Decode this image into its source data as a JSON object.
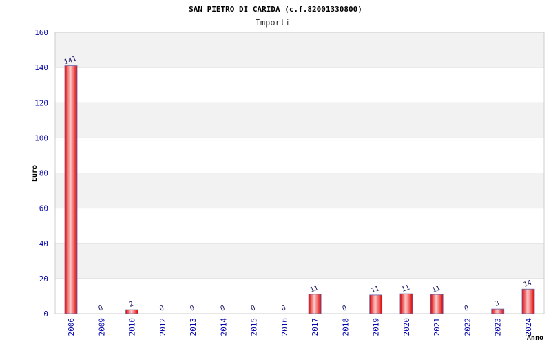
{
  "chart_data": {
    "type": "bar",
    "title": "SAN PIETRO DI CARIDA (c.f.82001330800)",
    "subtitle": "Importi",
    "xlabel": "Anno",
    "ylabel": "Euro",
    "ylim": [
      0,
      160
    ],
    "yticks": [
      0,
      20,
      40,
      60,
      80,
      100,
      120,
      140,
      160
    ],
    "categories": [
      "2006",
      "2009",
      "2010",
      "2012",
      "2013",
      "2014",
      "2015",
      "2016",
      "2017",
      "2018",
      "2019",
      "2020",
      "2021",
      "2022",
      "2023",
      "2024"
    ],
    "values": [
      141,
      0,
      2,
      0,
      0,
      0,
      0,
      0,
      11,
      0,
      11,
      11,
      11,
      0,
      3,
      14
    ],
    "bar_values": [
      141,
      0,
      2.3,
      0,
      0,
      0,
      0,
      0,
      11,
      0,
      10.6,
      11.3,
      10.9,
      0,
      2.7,
      14
    ],
    "data_labels": [
      "141",
      "0",
      "2",
      "0",
      "0",
      "0",
      "0",
      "0",
      "11",
      "0",
      "11",
      "11",
      "11",
      "0",
      "3",
      "14"
    ],
    "grid": true,
    "colors": {
      "bar_center": "#ffcccc",
      "bar_edge": "#dd0000",
      "band": "#f2f2f2",
      "tick_text": "#0000aa"
    }
  }
}
